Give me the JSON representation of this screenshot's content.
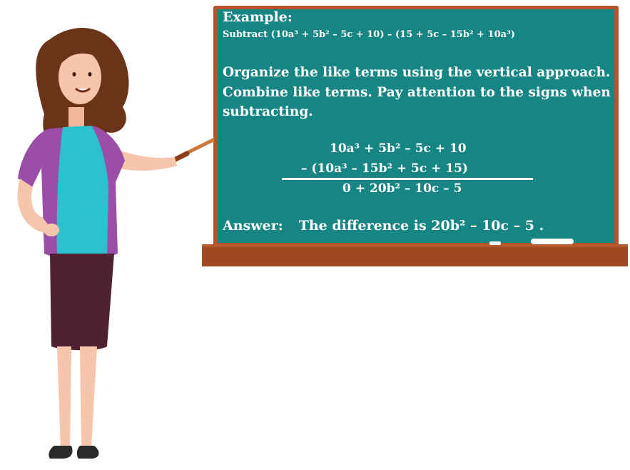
{
  "board": {
    "example_label": "Example:",
    "problem": "Subtract (10a³  + 5b²  – 5c + 10) – (15 + 5c  – 15b² + 10a³)",
    "instructions": "Organize the like terms using the vertical approach. Combine like terms. Pay attention to the signs when subtracting.",
    "equation_line1": "10a³ + 5b² – 5c + 10",
    "equation_line2": "–  (10a³ – 15b² + 5c + 15)",
    "equation_result": "0  +  20b² – 10c – 5",
    "answer_label": "Answer:",
    "answer_text": "The difference is 20b² – 10c – 5 ."
  },
  "colors": {
    "board_green": "#178584",
    "frame_brown": "#b5542c",
    "chalk_white": "#ffffff"
  },
  "illustration": {
    "subject": "teacher-with-pointer"
  }
}
